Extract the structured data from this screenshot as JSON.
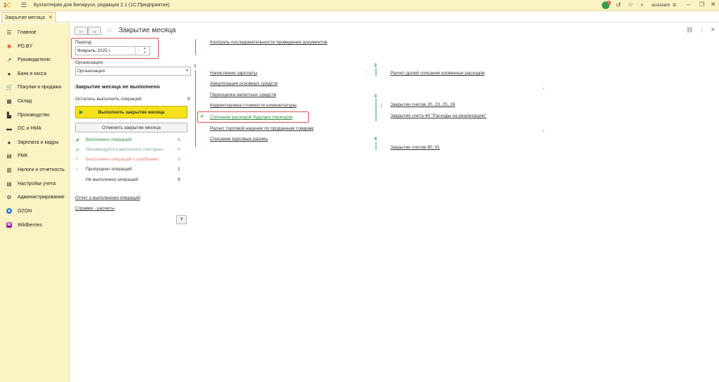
{
  "window": {
    "title": "Бухгалтерия для Беларуси, редакция 2.1  (1С:Предприятие)",
    "user": "assistant",
    "notif_count": "1"
  },
  "tabs": [
    {
      "label": "Закрытие месяца"
    }
  ],
  "sidebar": {
    "items": [
      {
        "label": "Главное",
        "icon": "menu-lines-icon"
      },
      {
        "label": "РО.BY",
        "icon": "asterisk-icon"
      },
      {
        "label": "Руководителю",
        "icon": "trend-icon"
      },
      {
        "label": "Банк и касса",
        "icon": "coin-icon"
      },
      {
        "label": "Покупки и продажи",
        "icon": "cart-icon"
      },
      {
        "label": "Склад",
        "icon": "warehouse-icon"
      },
      {
        "label": "Производство",
        "icon": "factory-icon"
      },
      {
        "label": "ОС и НМА",
        "icon": "truck-icon"
      },
      {
        "label": "Зарплата и кадры",
        "icon": "person-icon"
      },
      {
        "label": "РМК",
        "icon": "register-icon"
      },
      {
        "label": "Налоги и отчетность",
        "icon": "report-icon"
      },
      {
        "label": "Настройки учета",
        "icon": "settings-doc-icon"
      },
      {
        "label": "Администрирование",
        "icon": "gear-icon"
      },
      {
        "label": "OZON",
        "icon": "ozon-icon"
      },
      {
        "label": "Wildberries",
        "icon": "wildberries-icon"
      }
    ]
  },
  "page": {
    "title": "Закрытие месяца"
  },
  "left": {
    "period_label": "Период:",
    "period_value": "Февраль 2025 г.",
    "org_label": "Организация:",
    "org_value": "Организация",
    "status_heading": "Закрытие месяца не выполнено",
    "remaining_label": "Осталось выполнить операций:",
    "remaining_count": "9",
    "run_button": "Выполнить закрытие месяца",
    "cancel_button": "Отменить закрытие месяца",
    "stats": [
      {
        "label": "Выполнено операций:",
        "count": "1",
        "color": "#2e8b3e"
      },
      {
        "label": "Рекомендуется выполнить повторно:",
        "count": "0",
        "color": "#7aa7a0"
      },
      {
        "label": "Выполнено операций с ошибками:",
        "count": "0",
        "color": "#e07b6f"
      },
      {
        "label": "Пропущено операций:",
        "count": "1",
        "color": "#333333"
      },
      {
        "label": "Не выполнено операций:",
        "count": "9",
        "color": "#333333"
      }
    ],
    "report_link": "Отчет о выполнении операций",
    "calc_link": "Справки - расчеты",
    "help_button": "?"
  },
  "ops": {
    "numbers": [
      "1",
      "2",
      "3",
      "4"
    ],
    "col1": [
      "Контроль последовательности проведения документов",
      "Начисление зарплаты",
      "Амортизация основных средств",
      "Переоценка валютных средств",
      "Корректировка стоимости номенклатуры",
      "Списание расходов будущих периодов",
      "Расчет торговой наценки по проданным товарам",
      "Списание курсовых разниц"
    ],
    "col2": [
      "Расчет долей списания косвенных расходов",
      "Закрытие счетов 20, 23, 25, 26",
      "Закрытие счета 44 \"Расходы на реализацию\"",
      "Закрытие счетов 90, 91"
    ]
  },
  "colors": {
    "accent_yellow": "#f5e11c",
    "sidebar_bg": "#fbf3c3",
    "highlight_red": "#d9534f",
    "green": "#2f8f56"
  }
}
